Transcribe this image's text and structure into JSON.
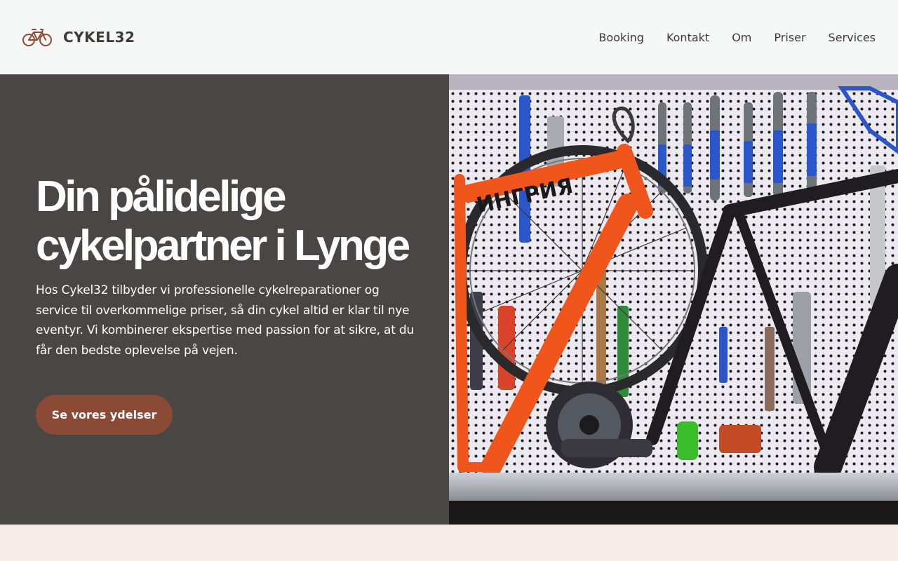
{
  "brand": {
    "name": "CYKEL32",
    "icon": "bicycle-icon",
    "icon_color": "#8b4a36"
  },
  "nav": {
    "items": [
      {
        "label": "Booking"
      },
      {
        "label": "Kontakt"
      },
      {
        "label": "Om"
      },
      {
        "label": "Priser"
      },
      {
        "label": "Services"
      }
    ]
  },
  "hero": {
    "title_line1": "Din pålidelige",
    "title_line2": "cykelpartner i Lynge",
    "text": "Hos Cykel32 tilbyder vi professionelle cykelreparationer og service til overkommelige priser, så din cykel altid er klar til nye eventyr. Vi kombinerer ekspertise med passion for at sikre, at du får den bedste oplevelse på vejen.",
    "cta_label": "Se vores ydelser",
    "frame_text": "ИНГРИЯ",
    "colors": {
      "panel": "#4a4645",
      "cta": "#8b4a36",
      "frame": "#f0551c",
      "pegboard": "#eceaf0"
    }
  }
}
